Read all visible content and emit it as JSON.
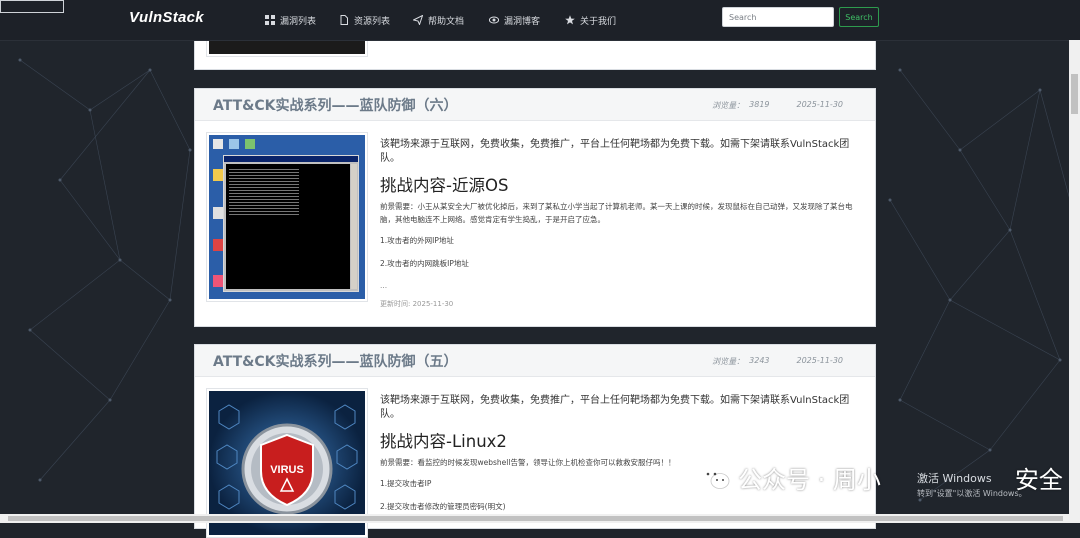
{
  "nav": {
    "brand": "VulnStack",
    "items": [
      {
        "label": "漏洞列表",
        "icon": "grid-icon"
      },
      {
        "label": "资源列表",
        "icon": "file-icon"
      },
      {
        "label": "帮助文档",
        "icon": "send-icon"
      },
      {
        "label": "漏洞博客",
        "icon": "eye-icon"
      },
      {
        "label": "关于我们",
        "icon": "star-icon"
      }
    ],
    "search_placeholder": "Search",
    "search_button": "Search"
  },
  "posts": [
    {
      "title": "ATT&CK实战系列——蓝队防御（六）",
      "views_label": "浏览量：",
      "views": "3819",
      "date": "2025-11-30",
      "intro": "该靶场来源于互联网，免费收集，免费推广，平台上任何靶场都为免费下载。如需下架请联系VulnStack团队。",
      "challenge": "挑战内容-近源OS",
      "desc": "前景需要：小王从某安全大厂被优化掉后，来到了某私立小学当起了计算机老师。某一天上课的时候，发现鼠标在自己动弹，又发现除了某台电脑，其他电脑连不上网络。感觉肯定有学生捣乱，于是开启了应急。",
      "items": [
        "1.攻击者的外网IP地址",
        "2.攻击者的内网跳板IP地址"
      ],
      "ellipsis": "...",
      "updated": "更新时间: 2025-11-30"
    },
    {
      "title": "ATT&CK实战系列——蓝队防御（五）",
      "views_label": "浏览量：",
      "views": "3243",
      "date": "2025-11-30",
      "intro": "该靶场来源于互联网，免费收集，免费推广，平台上任何靶场都为免费下载。如需下架请联系VulnStack团队。",
      "challenge": "挑战内容-Linux2",
      "desc": "前景需要：看监控的时候发现webshell告警，领导让你上机检查你可以救救安服仔吗！！",
      "items": [
        "1.提交攻击者IP",
        "2.提交攻击者修改的管理员密码(明文)"
      ]
    }
  ],
  "thumb_virus_text": "VIRUS",
  "overlay": {
    "watermark": "公众号 · 周小",
    "watermark_tail": "安全",
    "activate_title": "激活 Windows",
    "activate_sub": "转到\"设置\"以激活 Windows。"
  }
}
